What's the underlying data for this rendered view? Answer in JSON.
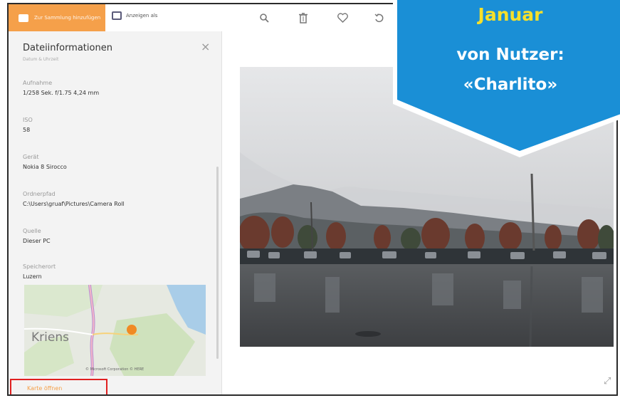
{
  "toolbar": {
    "primary_label": "Zur Sammlung hinzufügen",
    "secondary_label": "Anzeigen als"
  },
  "sidebar": {
    "title": "Dateiinformationen",
    "subtitle": "Datum & Uhrzeit",
    "fields": [
      {
        "key": "Aufnahme",
        "value": "1/258 Sek. f/1.75 4,24 mm"
      },
      {
        "key": "ISO",
        "value": "58"
      },
      {
        "key": "Gerät",
        "value": "Nokia 8 Sirocco"
      },
      {
        "key": "Ordnerpfad",
        "value": "C:\\Users\\gruaf\\Pictures\\Camera Roll"
      },
      {
        "key": "Quelle",
        "value": "Dieser PC"
      },
      {
        "key": "Speicherort",
        "value": "Luzern"
      }
    ],
    "map": {
      "city_label": "Kriens",
      "attribution": "© Microsoft Corporation © HERE"
    },
    "map_link": "Karte öffnen"
  },
  "banner": {
    "month": "Januar",
    "line1": "von Nutzer:",
    "line2": "«Charlito»",
    "color": "#1a8fd6",
    "accent": "#f6e02a"
  },
  "icons": [
    "folder-icon",
    "slideshow-icon",
    "zoom-icon",
    "delete-icon",
    "favorite-icon",
    "rotate-icon",
    "close-icon",
    "expand-icon",
    "map-pin-icon"
  ]
}
